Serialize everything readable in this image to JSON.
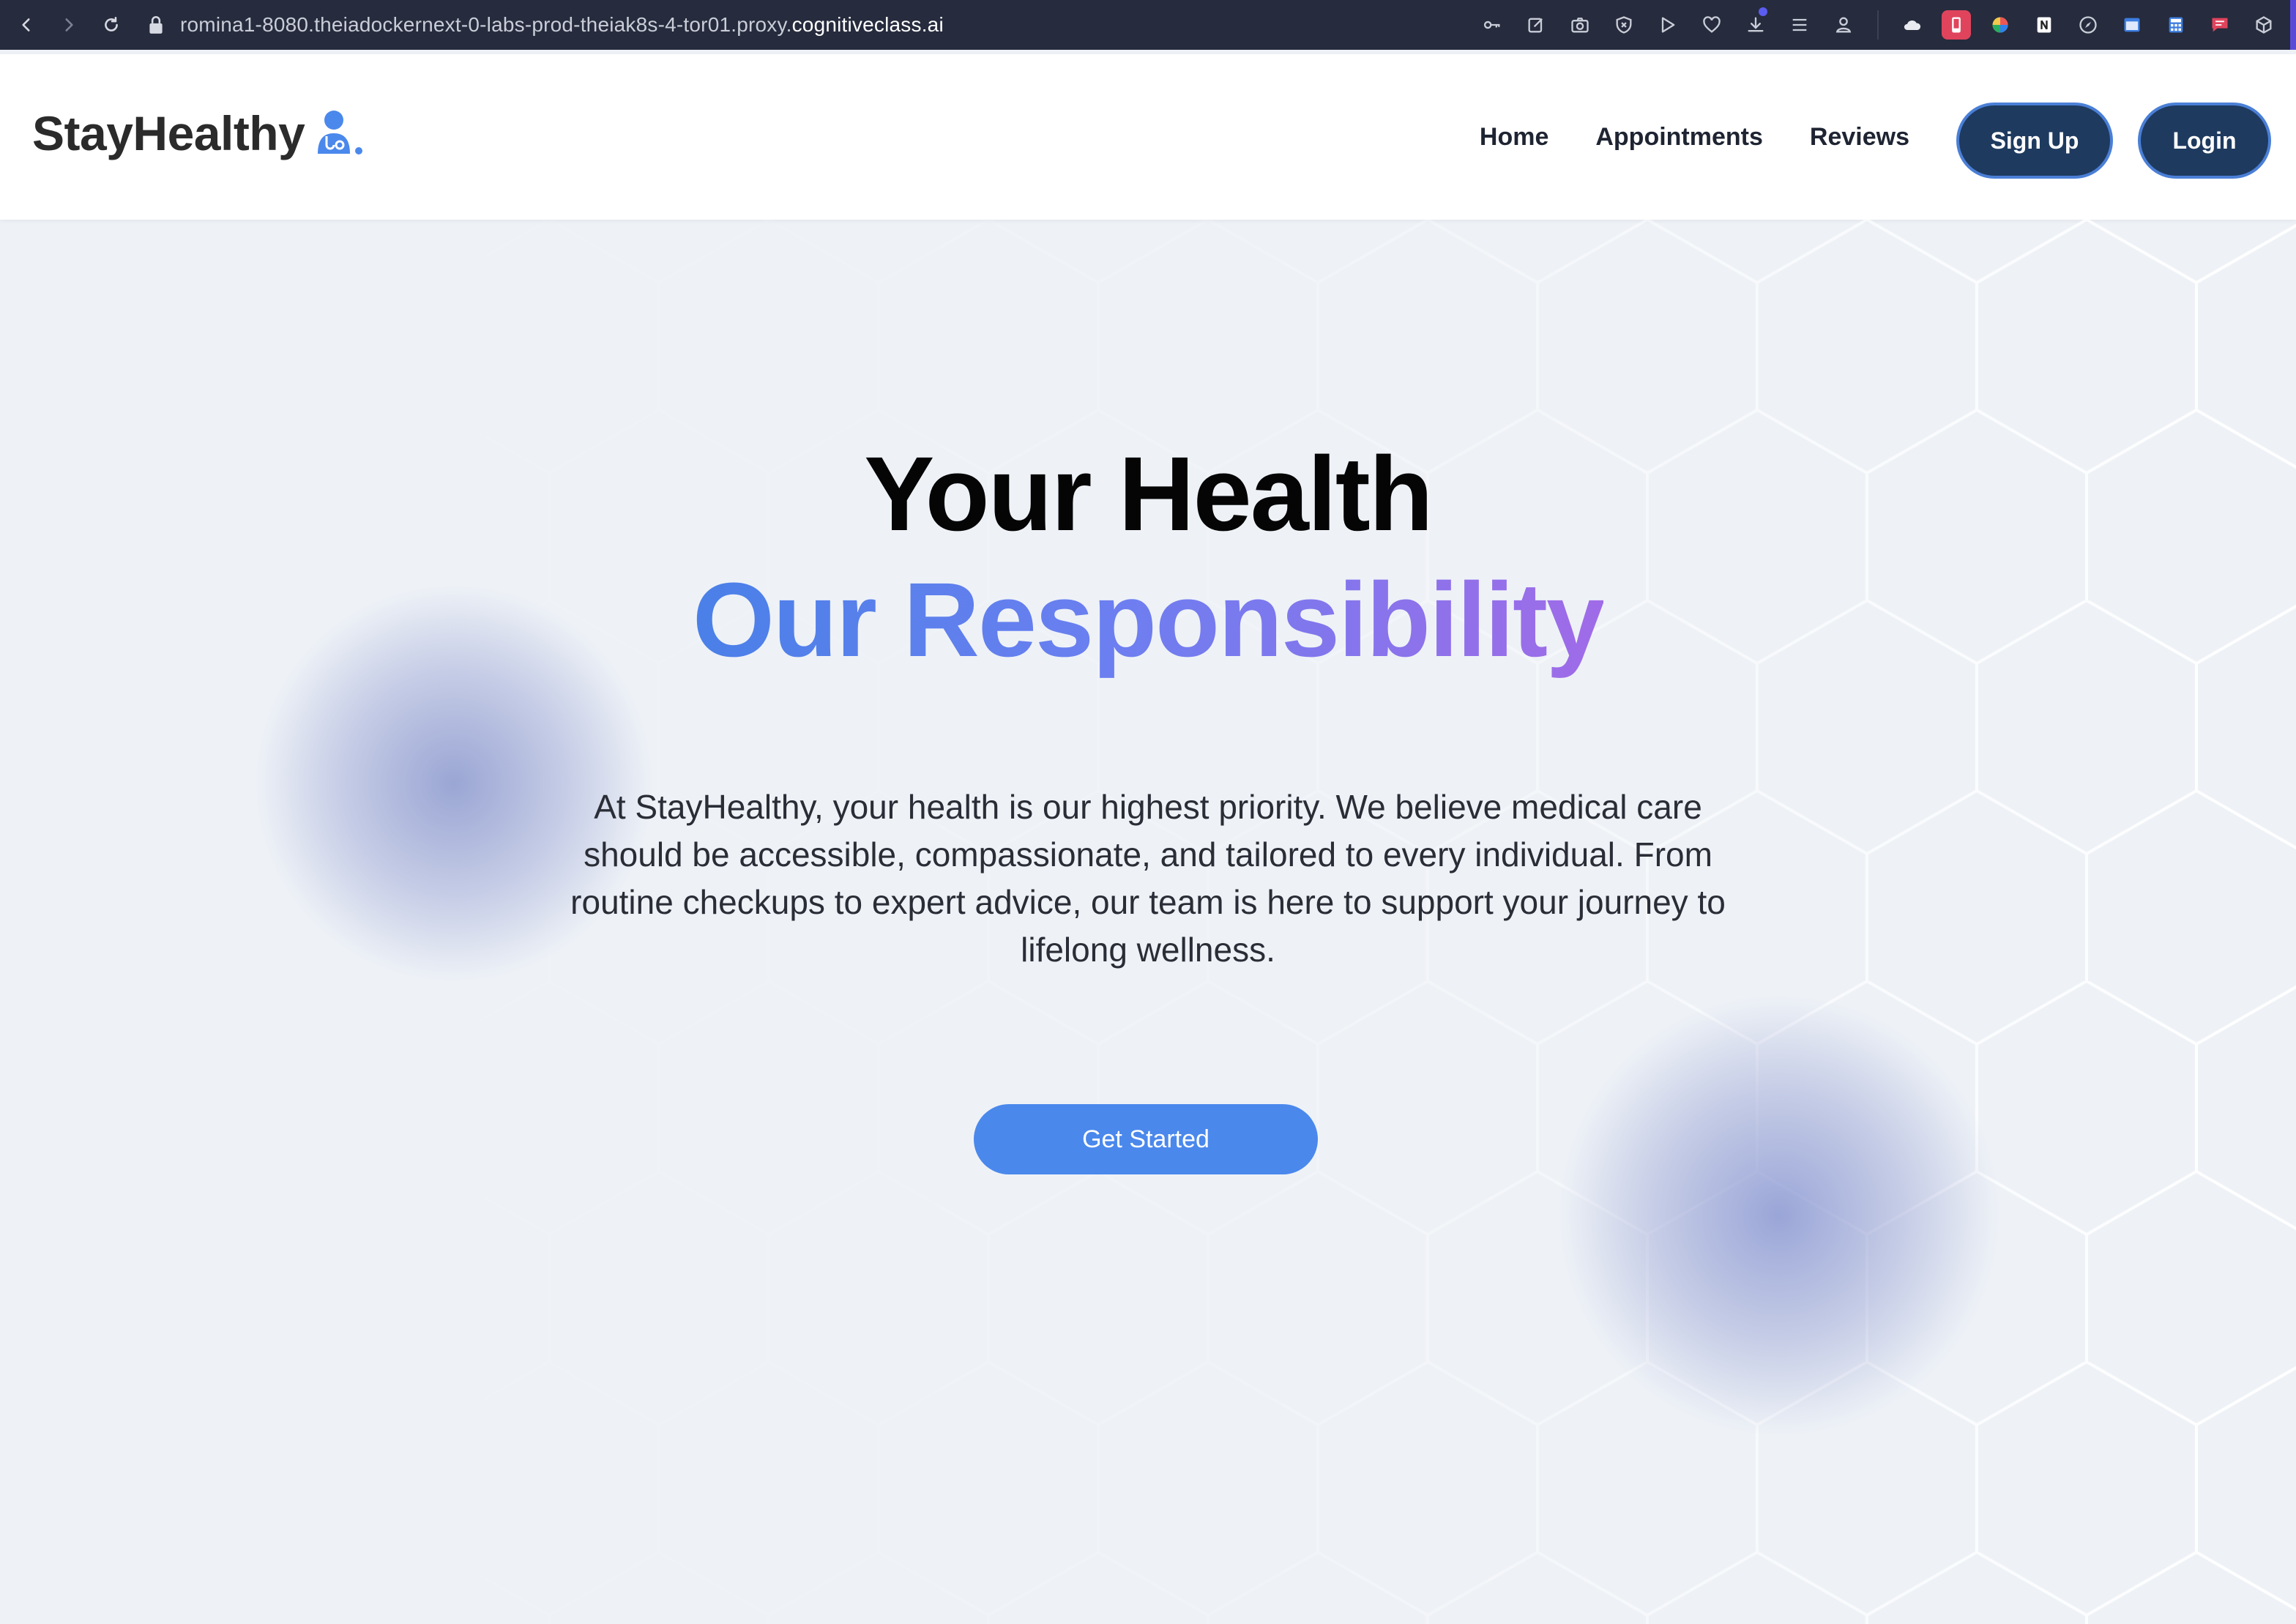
{
  "browser": {
    "url_prefix": "romina1-8080.theiadockernext-0-labs-prod-theiak8s-4-tor01.proxy.",
    "url_domain": "cognitiveclass.ai"
  },
  "header": {
    "brand": "StayHealthy",
    "nav": [
      "Home",
      "Appointments",
      "Reviews"
    ],
    "signup_label": "Sign Up",
    "login_label": "Login"
  },
  "hero": {
    "title": "Your Health",
    "subtitle": "Our Responsibility",
    "description": "At StayHealthy, your health is our highest priority. We believe medical care should be accessible, compassionate, and tailored to every individual. From routine checkups to expert advice, our team is here to support your journey to lifelong wellness.",
    "cta_label": "Get Started"
  },
  "colors": {
    "accent": "#4a88ec",
    "dark_button": "#1e3a5f",
    "gradient_start": "#4a80e8",
    "gradient_end": "#a06be8"
  }
}
